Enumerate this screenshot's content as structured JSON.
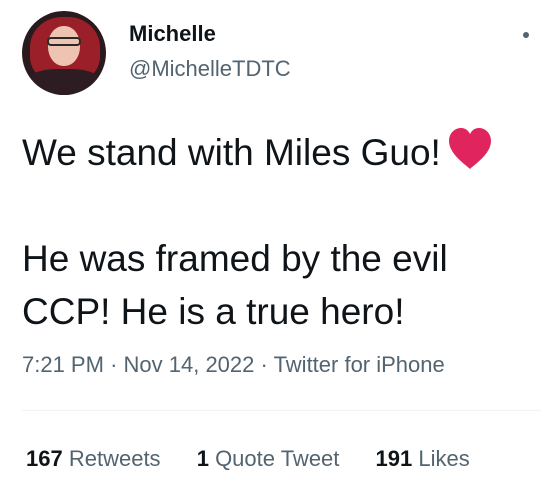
{
  "user": {
    "name": "Michelle",
    "handle": "@MichelleTDTC"
  },
  "tweet": {
    "line1": "We stand with Miles Guo!",
    "line2": "He was framed by the evil\nCCP! He is a true hero!",
    "emoji": "heart-emoji",
    "time": "7:21 PM",
    "date": "Nov 14, 2022",
    "source": "Twitter for iPhone",
    "sep": "·"
  },
  "stats": [
    {
      "count": "167",
      "label": "Retweets"
    },
    {
      "count": "1",
      "label": "Quote Tweet"
    },
    {
      "count": "191",
      "label": "Likes"
    }
  ],
  "colors": {
    "text": "#0f1419",
    "secondary": "#536471",
    "heart": "#e0245e",
    "divider": "#eff3f4"
  }
}
